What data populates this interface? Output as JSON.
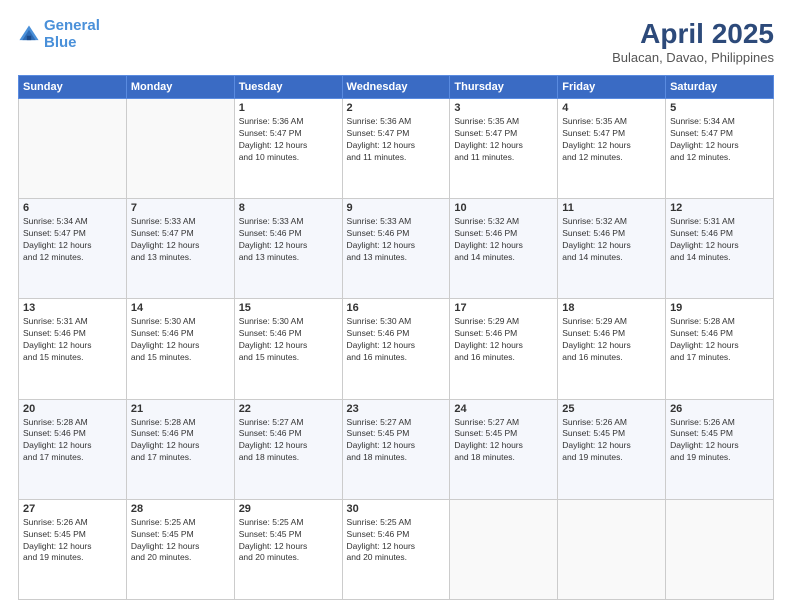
{
  "logo": {
    "line1": "General",
    "line2": "Blue"
  },
  "title": "April 2025",
  "subtitle": "Bulacan, Davao, Philippines",
  "days_header": [
    "Sunday",
    "Monday",
    "Tuesday",
    "Wednesday",
    "Thursday",
    "Friday",
    "Saturday"
  ],
  "weeks": [
    [
      {
        "day": "",
        "info": ""
      },
      {
        "day": "",
        "info": ""
      },
      {
        "day": "1",
        "info": "Sunrise: 5:36 AM\nSunset: 5:47 PM\nDaylight: 12 hours\nand 10 minutes."
      },
      {
        "day": "2",
        "info": "Sunrise: 5:36 AM\nSunset: 5:47 PM\nDaylight: 12 hours\nand 11 minutes."
      },
      {
        "day": "3",
        "info": "Sunrise: 5:35 AM\nSunset: 5:47 PM\nDaylight: 12 hours\nand 11 minutes."
      },
      {
        "day": "4",
        "info": "Sunrise: 5:35 AM\nSunset: 5:47 PM\nDaylight: 12 hours\nand 12 minutes."
      },
      {
        "day": "5",
        "info": "Sunrise: 5:34 AM\nSunset: 5:47 PM\nDaylight: 12 hours\nand 12 minutes."
      }
    ],
    [
      {
        "day": "6",
        "info": "Sunrise: 5:34 AM\nSunset: 5:47 PM\nDaylight: 12 hours\nand 12 minutes."
      },
      {
        "day": "7",
        "info": "Sunrise: 5:33 AM\nSunset: 5:47 PM\nDaylight: 12 hours\nand 13 minutes."
      },
      {
        "day": "8",
        "info": "Sunrise: 5:33 AM\nSunset: 5:46 PM\nDaylight: 12 hours\nand 13 minutes."
      },
      {
        "day": "9",
        "info": "Sunrise: 5:33 AM\nSunset: 5:46 PM\nDaylight: 12 hours\nand 13 minutes."
      },
      {
        "day": "10",
        "info": "Sunrise: 5:32 AM\nSunset: 5:46 PM\nDaylight: 12 hours\nand 14 minutes."
      },
      {
        "day": "11",
        "info": "Sunrise: 5:32 AM\nSunset: 5:46 PM\nDaylight: 12 hours\nand 14 minutes."
      },
      {
        "day": "12",
        "info": "Sunrise: 5:31 AM\nSunset: 5:46 PM\nDaylight: 12 hours\nand 14 minutes."
      }
    ],
    [
      {
        "day": "13",
        "info": "Sunrise: 5:31 AM\nSunset: 5:46 PM\nDaylight: 12 hours\nand 15 minutes."
      },
      {
        "day": "14",
        "info": "Sunrise: 5:30 AM\nSunset: 5:46 PM\nDaylight: 12 hours\nand 15 minutes."
      },
      {
        "day": "15",
        "info": "Sunrise: 5:30 AM\nSunset: 5:46 PM\nDaylight: 12 hours\nand 15 minutes."
      },
      {
        "day": "16",
        "info": "Sunrise: 5:30 AM\nSunset: 5:46 PM\nDaylight: 12 hours\nand 16 minutes."
      },
      {
        "day": "17",
        "info": "Sunrise: 5:29 AM\nSunset: 5:46 PM\nDaylight: 12 hours\nand 16 minutes."
      },
      {
        "day": "18",
        "info": "Sunrise: 5:29 AM\nSunset: 5:46 PM\nDaylight: 12 hours\nand 16 minutes."
      },
      {
        "day": "19",
        "info": "Sunrise: 5:28 AM\nSunset: 5:46 PM\nDaylight: 12 hours\nand 17 minutes."
      }
    ],
    [
      {
        "day": "20",
        "info": "Sunrise: 5:28 AM\nSunset: 5:46 PM\nDaylight: 12 hours\nand 17 minutes."
      },
      {
        "day": "21",
        "info": "Sunrise: 5:28 AM\nSunset: 5:46 PM\nDaylight: 12 hours\nand 17 minutes."
      },
      {
        "day": "22",
        "info": "Sunrise: 5:27 AM\nSunset: 5:46 PM\nDaylight: 12 hours\nand 18 minutes."
      },
      {
        "day": "23",
        "info": "Sunrise: 5:27 AM\nSunset: 5:45 PM\nDaylight: 12 hours\nand 18 minutes."
      },
      {
        "day": "24",
        "info": "Sunrise: 5:27 AM\nSunset: 5:45 PM\nDaylight: 12 hours\nand 18 minutes."
      },
      {
        "day": "25",
        "info": "Sunrise: 5:26 AM\nSunset: 5:45 PM\nDaylight: 12 hours\nand 19 minutes."
      },
      {
        "day": "26",
        "info": "Sunrise: 5:26 AM\nSunset: 5:45 PM\nDaylight: 12 hours\nand 19 minutes."
      }
    ],
    [
      {
        "day": "27",
        "info": "Sunrise: 5:26 AM\nSunset: 5:45 PM\nDaylight: 12 hours\nand 19 minutes."
      },
      {
        "day": "28",
        "info": "Sunrise: 5:25 AM\nSunset: 5:45 PM\nDaylight: 12 hours\nand 20 minutes."
      },
      {
        "day": "29",
        "info": "Sunrise: 5:25 AM\nSunset: 5:45 PM\nDaylight: 12 hours\nand 20 minutes."
      },
      {
        "day": "30",
        "info": "Sunrise: 5:25 AM\nSunset: 5:46 PM\nDaylight: 12 hours\nand 20 minutes."
      },
      {
        "day": "",
        "info": ""
      },
      {
        "day": "",
        "info": ""
      },
      {
        "day": "",
        "info": ""
      }
    ]
  ]
}
